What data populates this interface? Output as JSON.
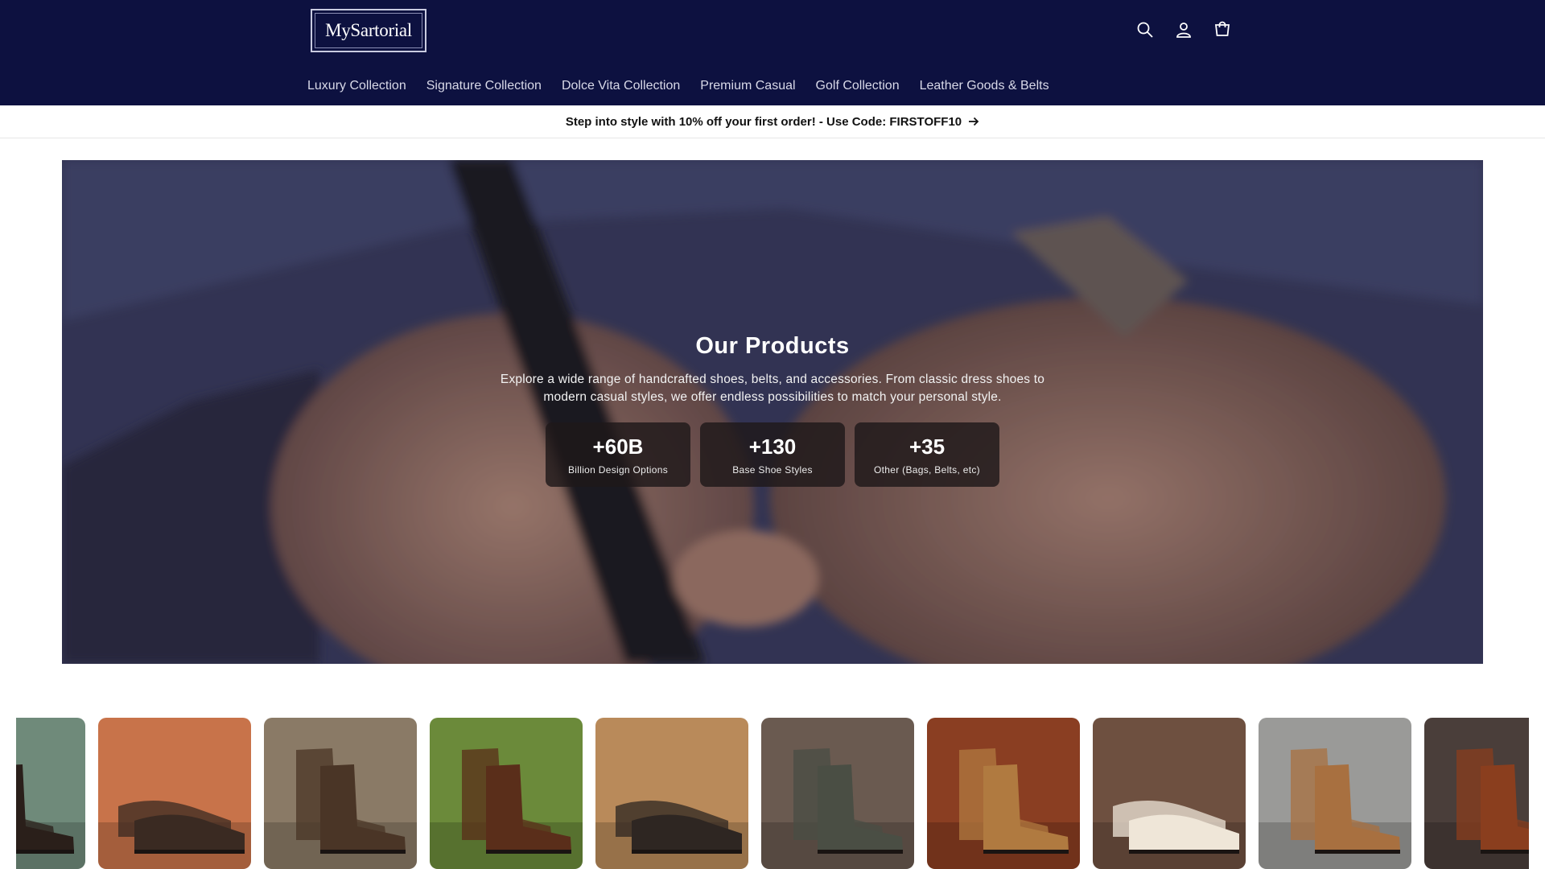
{
  "header": {
    "logo_text": "MySartorial",
    "icons": [
      "search-icon",
      "account-icon",
      "cart-icon"
    ],
    "nav": [
      {
        "label": "Luxury Collection"
      },
      {
        "label": "Signature Collection"
      },
      {
        "label": "Dolce Vita Collection"
      },
      {
        "label": "Premium Casual"
      },
      {
        "label": "Golf Collection"
      },
      {
        "label": "Leather Goods & Belts"
      }
    ]
  },
  "announcement": {
    "text": "Step into style with 10% off your first order! - Use Code: FIRSTOFF10"
  },
  "hero": {
    "title": "Our Products",
    "description": "Explore a wide range of handcrafted shoes, belts, and accessories. From classic dress shoes to modern casual styles, we offer endless possibilities to match your personal style.",
    "stats": [
      {
        "value": "+60B",
        "label": "Billion Design Options"
      },
      {
        "value": "+130",
        "label": "Base Shoe Styles"
      },
      {
        "value": "+35",
        "label": "Other (Bags, Belts, etc)"
      }
    ]
  },
  "colors": {
    "header_bg": "#0d1140",
    "announcement_text": "#111111",
    "stat_card_bg": "#1e181a"
  },
  "carousel": {
    "items": [
      {
        "name": "dark-leather-boot",
        "bg": "#6f8a7a",
        "shoe": "#2a1f1a"
      },
      {
        "name": "brick-wall-boot",
        "bg": "#c8734a",
        "shoe": "#3a2a22"
      },
      {
        "name": "houndstooth-boot",
        "bg": "#8a7a66",
        "shoe": "#4a3526"
      },
      {
        "name": "patina-boot-on-leaves",
        "bg": "#6b8a3a",
        "shoe": "#5a2e1a"
      },
      {
        "name": "velvet-loafer",
        "bg": "#b98a5a",
        "shoe": "#2e2622"
      },
      {
        "name": "camo-slip-on",
        "bg": "#6a5a50",
        "shoe": "#4a4e44"
      },
      {
        "name": "tassel-loafer-sole",
        "bg": "#8a3e22",
        "shoe": "#b07a40"
      },
      {
        "name": "cream-chelsea-boot",
        "bg": "#6e5040",
        "shoe": "#efe6d8"
      },
      {
        "name": "leopard-chelsea-boot",
        "bg": "#9a9a98",
        "shoe": "#a87040"
      },
      {
        "name": "tan-chelsea-boot",
        "bg": "#4a3e3a",
        "shoe": "#8a3e1e"
      }
    ]
  }
}
